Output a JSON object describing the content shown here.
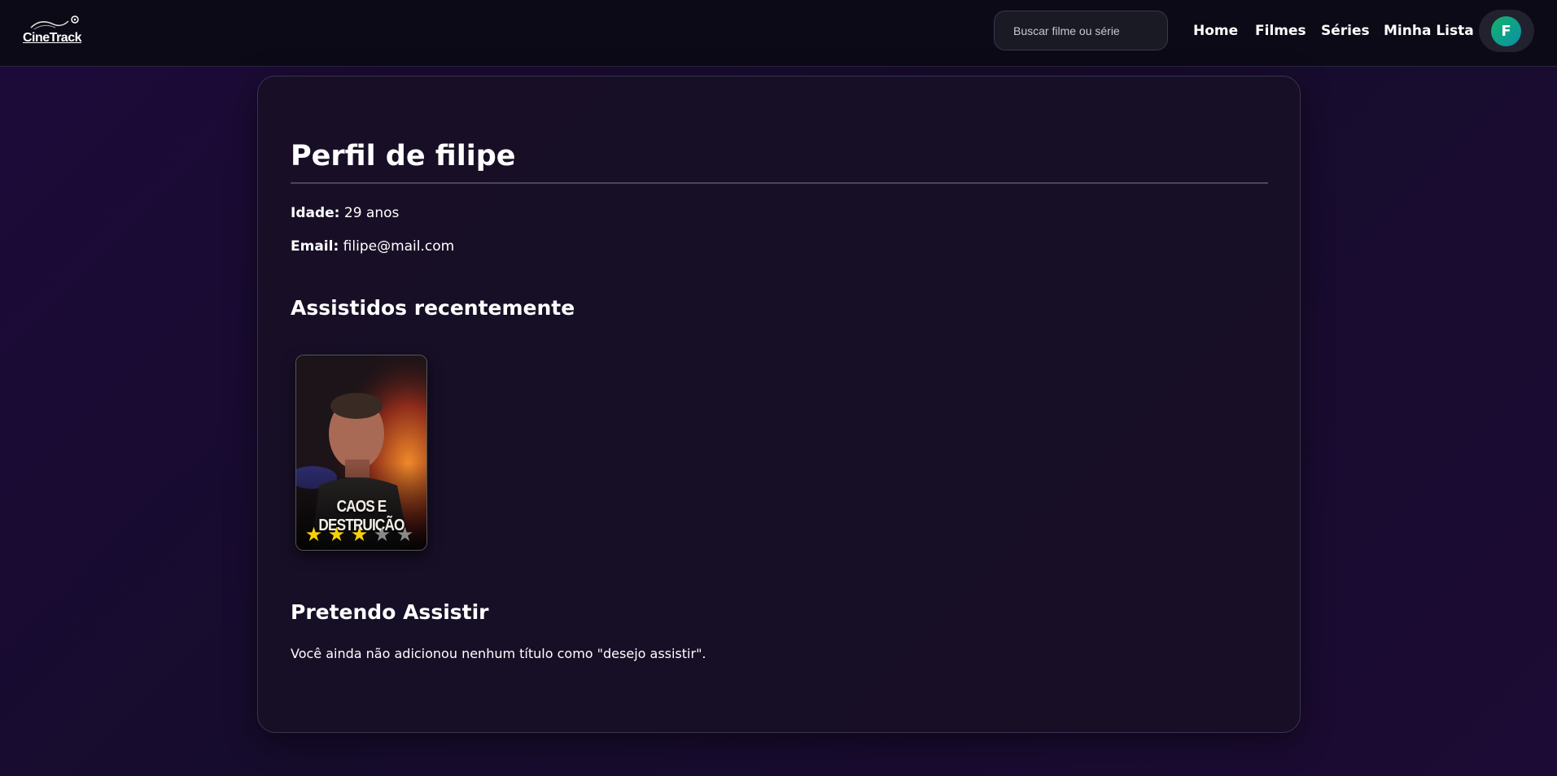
{
  "header": {
    "logo_text": "CineTrack",
    "search_placeholder": "Buscar filme ou série",
    "nav": [
      "Home",
      "Filmes",
      "Séries",
      "Minha Lista"
    ],
    "avatar_initial": "F"
  },
  "profile": {
    "title": "Perfil de filipe",
    "age_label": "Idade:",
    "age_value": "29 anos",
    "email_label": "Email:",
    "email_value": "filipe@mail.com"
  },
  "recent": {
    "heading": "Assistidos recentemente",
    "items": [
      {
        "poster_title": "CAOS E DESTRUIÇÃO",
        "rating": 3,
        "max_rating": 5
      }
    ]
  },
  "watchlist": {
    "heading": "Pretendo Assistir",
    "empty_message": "Você ainda não adicionou nenhum título como \"desejo assistir\"."
  },
  "colors": {
    "star_on": "#f5d10a",
    "star_off": "#8a8a8a",
    "avatar_gradient": [
      "#13b26a",
      "#0a8fa8"
    ]
  }
}
